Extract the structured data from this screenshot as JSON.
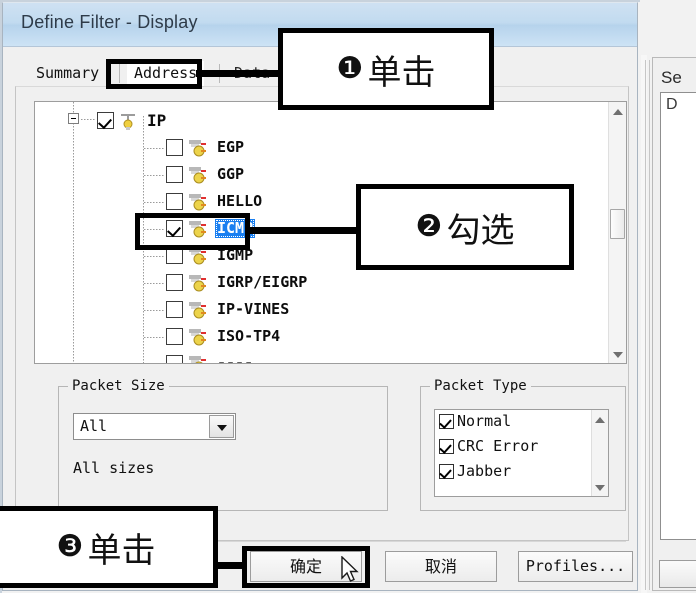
{
  "window": {
    "title": "Define Filter - Display"
  },
  "tabs": [
    {
      "label": "Summary",
      "name": "tab-summary",
      "selected": false
    },
    {
      "label": "Address",
      "name": "tab-address",
      "selected": true
    },
    {
      "label": "Data ..",
      "name": "tab-data",
      "selected": false
    }
  ],
  "protocol_tree": {
    "root": {
      "label": "IP",
      "checked": true,
      "expanded": true
    },
    "items": [
      {
        "label": "EGP",
        "checked": false,
        "selected": false
      },
      {
        "label": "GGP",
        "checked": false,
        "selected": false
      },
      {
        "label": "HELLO",
        "checked": false,
        "selected": false
      },
      {
        "label": "ICMP",
        "checked": true,
        "selected": true
      },
      {
        "label": "IGMP",
        "checked": false,
        "selected": false
      },
      {
        "label": "IGRP/EIGRP",
        "checked": false,
        "selected": false
      },
      {
        "label": "IP-VINES",
        "checked": false,
        "selected": false
      },
      {
        "label": "ISO-TP4",
        "checked": false,
        "selected": false
      },
      {
        "label": "----",
        "checked": false,
        "selected": false
      }
    ],
    "scrollbar": {
      "up_icon": "scroll-up-arrow-icon",
      "down_icon": "scroll-down-arrow-icon"
    }
  },
  "packet_size": {
    "group_title": "Packet Size",
    "combo_value": "All",
    "combo_icon": "chevron-down-icon",
    "description": "All sizes"
  },
  "packet_type": {
    "group_title": "Packet Type",
    "items": [
      {
        "label": "Normal",
        "checked": true
      },
      {
        "label": "CRC Error",
        "checked": true
      },
      {
        "label": "Jabber",
        "checked": true
      }
    ]
  },
  "buttons": {
    "ok": "确定",
    "cancel": "取消",
    "profiles": "Profiles..."
  },
  "side_panel": {
    "title": "Se",
    "list_first_item": "D"
  },
  "annotations": [
    {
      "marker": "❶",
      "text": "单击",
      "name": "callout-step-1"
    },
    {
      "marker": "❷",
      "text": "勾选",
      "name": "callout-step-2"
    },
    {
      "marker": "❸",
      "text": "单击",
      "name": "callout-step-3"
    }
  ],
  "colors": {
    "titlebar": "#c2dbf0",
    "selection": "#1a7ff0",
    "annotation": "#000000",
    "dialog_face": "#f0f0f0"
  }
}
